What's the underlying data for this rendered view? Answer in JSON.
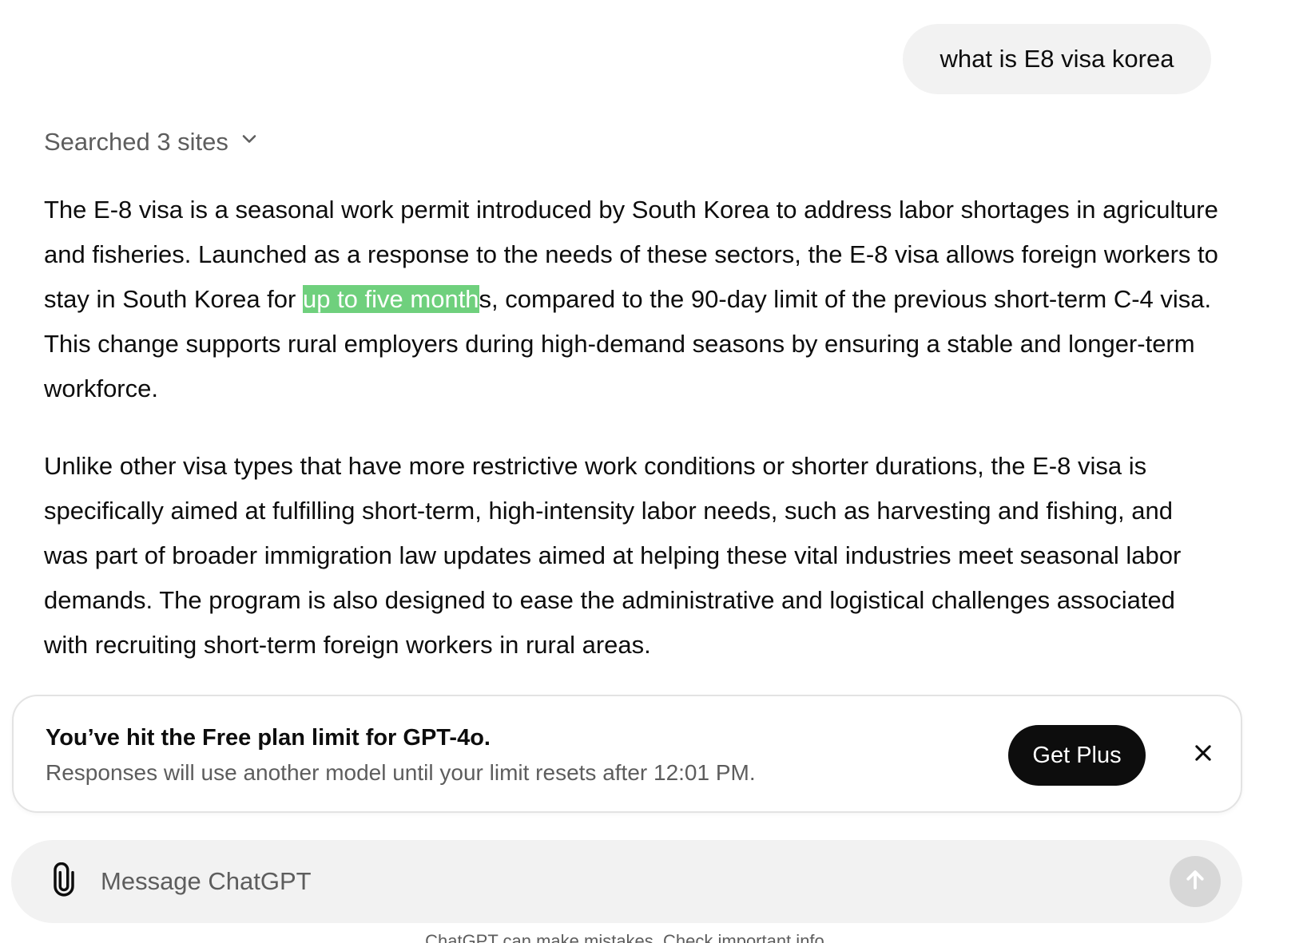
{
  "conversation": {
    "user_message": "what is E8 visa korea",
    "searched_label": "Searched 3 sites",
    "answer": {
      "para1_before": "The E-8 visa is a seasonal work permit introduced by South Korea to address labor shortages in agriculture and fisheries. Launched as a response to the needs of these sectors, the E-8 visa allows foreign workers to stay in South Korea for ",
      "para1_highlight": "up to five month",
      "para1_after": "s, compared to the 90-day limit of the previous short-term C-4 visa. This change supports rural employers during high-demand seasons by ensuring a stable and longer-term workforce.",
      "para2": "Unlike other visa types that have more restrictive work conditions or shorter durations, the E-8 visa is specifically aimed at fulfilling short-term, high-intensity labor needs, such as harvesting and fishing, and was part of broader immigration law updates aimed at helping these vital industries meet seasonal labor demands. The program is also designed to ease the administrative and logistical challenges associated with recruiting short-term foreign workers in rural areas."
    }
  },
  "limit_banner": {
    "title": "You’ve hit the Free plan limit for GPT-4o.",
    "subtitle": "Responses will use another model until your limit resets after 12:01 PM.",
    "cta_label": "Get Plus"
  },
  "composer": {
    "placeholder": "Message ChatGPT"
  },
  "footer": {
    "note": "ChatGPT can make mistakes. Check important info."
  },
  "colors": {
    "highlight": "#6fd07d",
    "cta_bg": "#0d0d0d",
    "bubble_bg": "#f2f2f2",
    "send_disabled": "#d7d7d7"
  },
  "icons": {
    "searched": "chevron-down-icon",
    "close": "close-icon",
    "attach": "paperclip-icon",
    "send": "arrow-up-icon"
  }
}
